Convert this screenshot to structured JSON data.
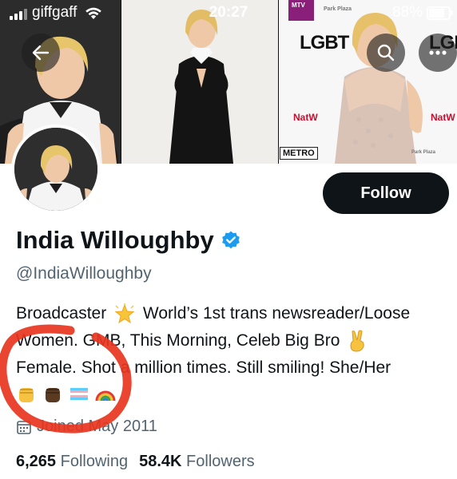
{
  "status_bar": {
    "carrier": "giffgaff",
    "time": "20:27",
    "battery": "88%"
  },
  "banner": {
    "signs": [
      "LGBT",
      "LGBT",
      "MTV",
      "Park Plaza",
      "Park Plaza"
    ],
    "nat_label_1": "NatW",
    "nat_label_2": "NatW",
    "metro": "METRO"
  },
  "profile": {
    "follow_label": "Follow",
    "name": "India Willoughby",
    "verified": true,
    "handle": "@IndiaWilloughby",
    "bio": {
      "line1a": "Broadcaster",
      "line1b": "World’s 1st trans newsreader/Loose",
      "line2": "Women. GMB, This Morning, Celeb Big Bro",
      "line3": "Female. Shot a million times. Still smiling! She/Her"
    },
    "emojis": [
      "raised-fist-medium",
      "raised-fist-dark",
      "transgender-flag",
      "rainbow"
    ],
    "joined": "Joined May 2011",
    "following_count": "6,265",
    "following_label": "Following",
    "followers_count": "58.4K",
    "followers_label": "Followers"
  },
  "colors": {
    "text": "#0f1419",
    "secondary": "#536471",
    "verified": "#1d9bf0",
    "scribble": "#e8351e"
  }
}
